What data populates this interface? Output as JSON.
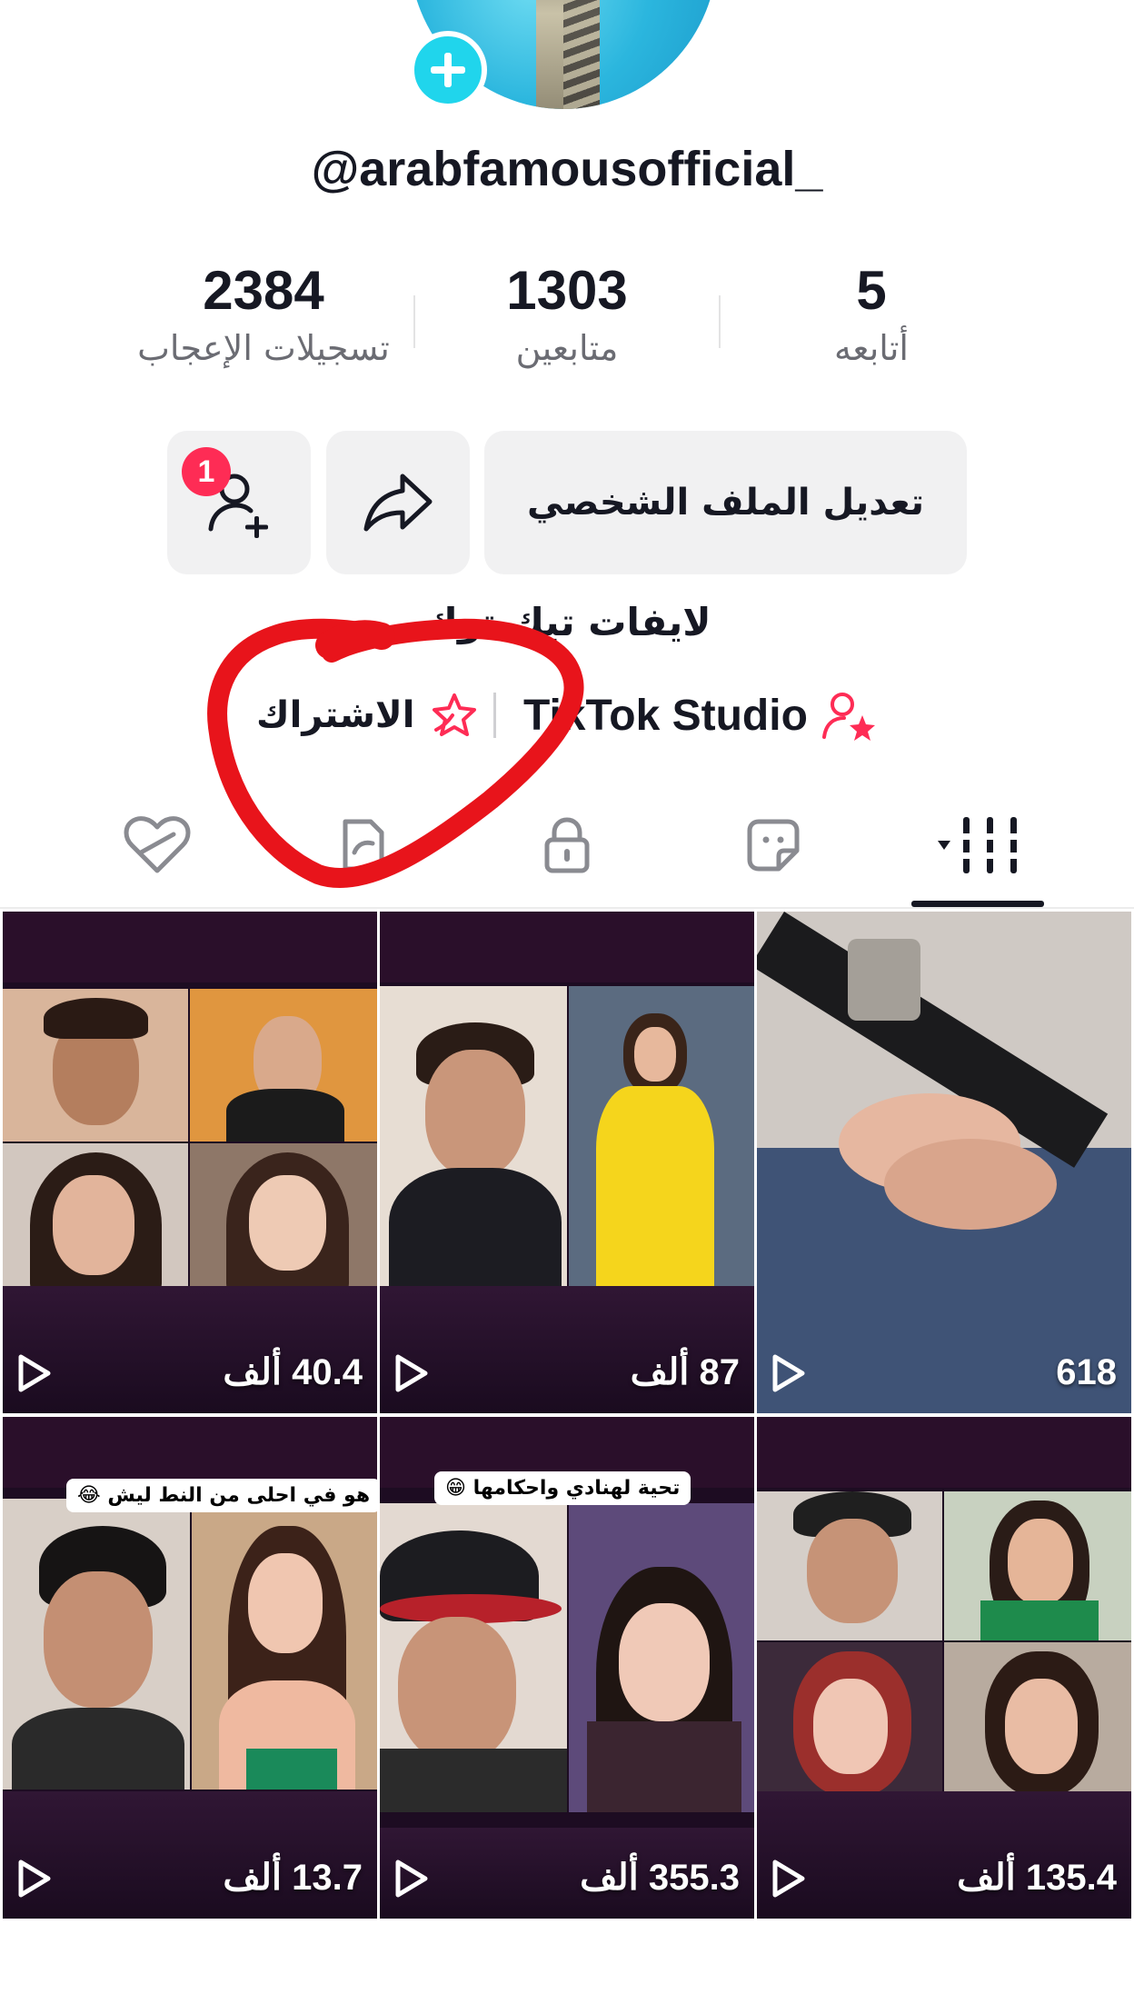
{
  "profile": {
    "username": "@arabfamousofficial_",
    "bio": "لايفات تيك توك"
  },
  "stats": {
    "following": {
      "value": "5",
      "label": "أتابعه"
    },
    "followers": {
      "value": "1303",
      "label": "متابعين"
    },
    "likes": {
      "value": "2384",
      "label": "تسجيلات الإعجاب"
    }
  },
  "actions": {
    "edit_profile_label": "تعديل الملف الشخصي",
    "notification_count": "1"
  },
  "links": {
    "studio_label": "TikTok Studio",
    "subscription_label": "الاشتراك"
  },
  "tabs": [
    {
      "icon": "grid-icon",
      "active": true
    },
    {
      "icon": "sticker-icon"
    },
    {
      "icon": "lock-icon"
    },
    {
      "icon": "repost-icon"
    },
    {
      "icon": "liked-heart-icon"
    }
  ],
  "videos": [
    {
      "views": "40.4 ألف"
    },
    {
      "views": "87 ألف"
    },
    {
      "views": "618"
    },
    {
      "views": "13.7 ألف",
      "caption": "هو في احلى من النط ليش 😂"
    },
    {
      "views": "355.3 ألف",
      "caption": "تحية لهنادي واحكامها 😁"
    },
    {
      "views": "135.4 ألف"
    }
  ],
  "colors": {
    "accent_cyan": "#20d5ec",
    "accent_red": "#fe2c55",
    "annotation_red": "#e8141b",
    "button_bg": "#f1f1f2"
  }
}
